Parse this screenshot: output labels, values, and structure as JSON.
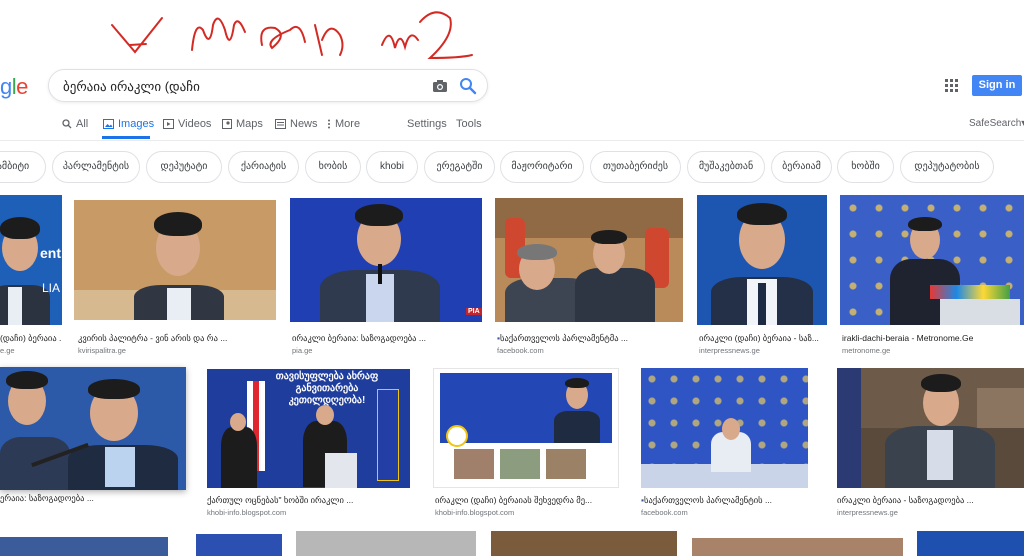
{
  "logo": {
    "part1": "g",
    "part2": "l",
    "part3": "e"
  },
  "search": {
    "query": "ბერაია ირაკლი (დაჩი"
  },
  "header": {
    "sign_in": "Sign in"
  },
  "tabs": [
    {
      "label": "All",
      "icon": "search-icon"
    },
    {
      "label": "Images",
      "icon": "image-icon",
      "active": true
    },
    {
      "label": "Videos",
      "icon": "video-icon"
    },
    {
      "label": "Maps",
      "icon": "map-icon"
    },
    {
      "label": "News",
      "icon": "news-icon"
    },
    {
      "label": "More",
      "icon": "more-icon"
    }
  ],
  "settings_label": "Settings",
  "tools_label": "Tools",
  "safesearch_label": "SafeSearch",
  "chips": [
    "ამბიტი",
    "პარლამენტის",
    "დეპუტატი",
    "ქარიატის",
    "ხობის",
    "khobi",
    "ერეგატში",
    "მაჟორიტარი",
    "თუთაბერიძეს",
    "მუშაკებთან",
    "ბერაიამ",
    "ხობში",
    "დეპუტატობის"
  ],
  "results_row1": [
    {
      "caption": "(დაჩი) ბერაია ...",
      "source": "e.ge",
      "overlay": "ent.",
      "overlay2": "LIA"
    },
    {
      "caption": "კვირის პალიტრა - ვინ არის და რა ...",
      "source": "kvirispalitra.ge"
    },
    {
      "caption": "ირაკლი ბერაია: საზოგადოება ...",
      "source": "pia.ge",
      "badge": "PIA"
    },
    {
      "caption": "საქართველოს პარლამენტმა ...",
      "source": "facebook.com"
    },
    {
      "caption": "ირაკლი (დაჩი) ბერაია - საზ...",
      "source": "interpressnews.ge"
    },
    {
      "caption": "irakli-dachi-beraia - Metronome.Ge",
      "source": "metronome.ge"
    }
  ],
  "results_row2": [
    {
      "caption": "ერაია: საზოგადოება ...",
      "source": ""
    },
    {
      "caption": "ქართულ ოცნებას\" ხობში ირაკლი ...",
      "source": "khobi-info.blogspot.com",
      "banner": "თავისუფლება ახრაფ განვითარება კეთილდღეობა!"
    },
    {
      "caption": "ირაკლი (დაჩი) ბერაიას შეხვედრა მე...",
      "source": "khobi-info.blogspot.com"
    },
    {
      "caption": "საქართველოს პარლამენტის ...",
      "source": "facebook.com"
    },
    {
      "caption": "ირაკლი ბერაია - საზოგადოება ...",
      "source": "interpressnews.ge"
    }
  ],
  "colors": {
    "accent": "#1a73e8",
    "sign_in": "#4285f4",
    "scribble": "#d42a24"
  }
}
